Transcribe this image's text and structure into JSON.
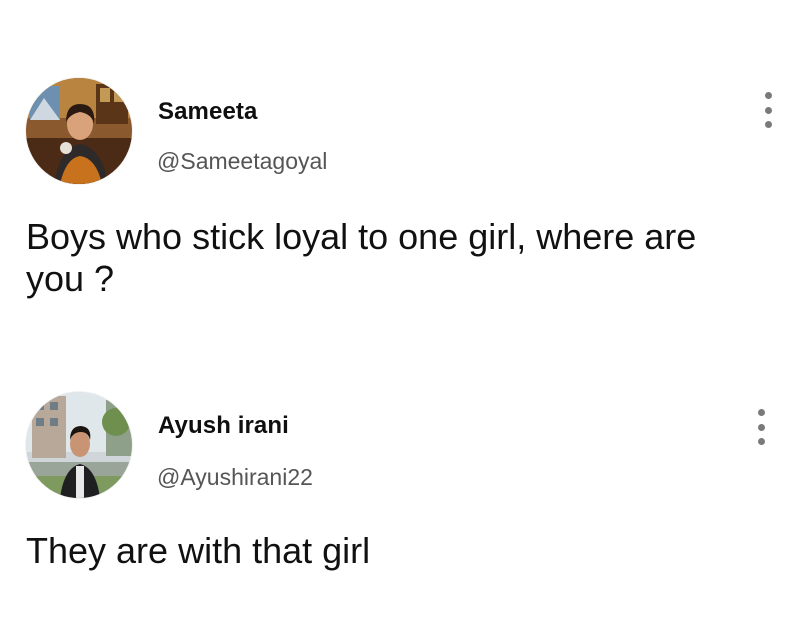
{
  "posts": [
    {
      "display_name": "Sameeta",
      "handle": "@Sameetagoyal",
      "text": "Boys who stick loyal to one girl, where are you ?",
      "avatar_icon": "profile-photo",
      "menu_icon": "more-vertical-icon"
    },
    {
      "display_name": "Ayush irani",
      "handle": "@Ayushirani22",
      "text": "They are with that girl",
      "avatar_icon": "profile-photo",
      "menu_icon": "more-vertical-icon"
    }
  ],
  "colors": {
    "background": "#ffffff",
    "text": "#111111",
    "handle": "#555555",
    "menu_dots": "#7a7a7a"
  }
}
